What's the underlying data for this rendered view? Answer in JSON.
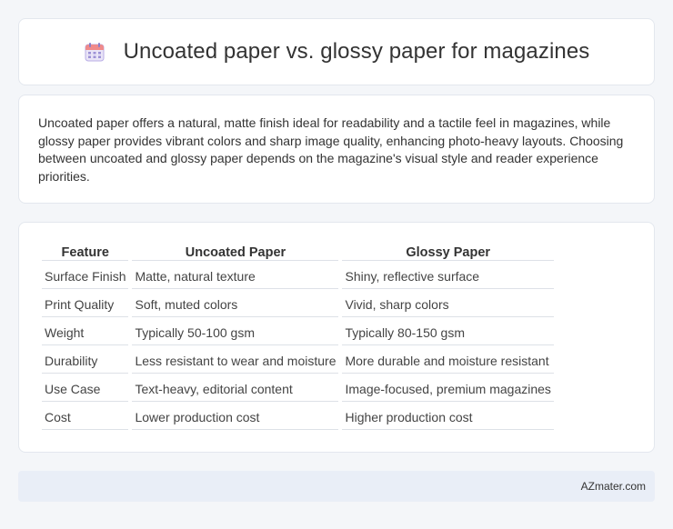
{
  "header": {
    "icon": "calendar-icon",
    "title": "Uncoated paper vs. glossy paper for magazines"
  },
  "intro": {
    "text": "Uncoated paper offers a natural, matte finish ideal for readability and a tactile feel in magazines, while glossy paper provides vibrant colors and sharp image quality, enhancing photo-heavy layouts. Choosing between uncoated and glossy paper depends on the magazine's visual style and reader experience priorities."
  },
  "table": {
    "headers": [
      "Feature",
      "Uncoated Paper",
      "Glossy Paper"
    ],
    "rows": [
      [
        "Surface Finish",
        "Matte, natural texture",
        "Shiny, reflective surface"
      ],
      [
        "Print Quality",
        "Soft, muted colors",
        "Vivid, sharp colors"
      ],
      [
        "Weight",
        "Typically 50-100 gsm",
        "Typically 80-150 gsm"
      ],
      [
        "Durability",
        "Less resistant to wear and moisture",
        "More durable and moisture resistant"
      ],
      [
        "Use Case",
        "Text-heavy, editorial content",
        "Image-focused, premium magazines"
      ],
      [
        "Cost",
        "Lower production cost",
        "Higher production cost"
      ]
    ]
  },
  "footer": {
    "brand": "AZmater.com"
  }
}
